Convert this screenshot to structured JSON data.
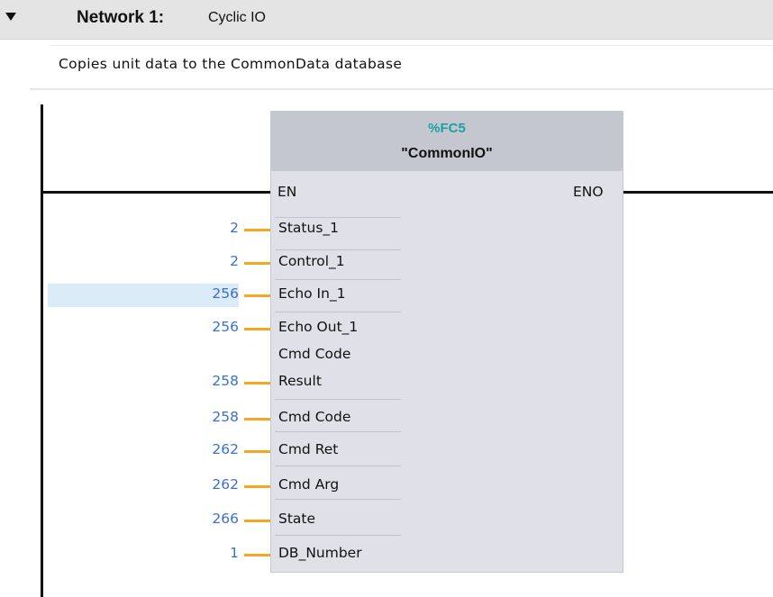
{
  "network": {
    "title": "Network 1:",
    "name": "Cyclic IO",
    "comment": "Copies unit data to the CommonData database",
    "collapse_icon": "triangle-down"
  },
  "block": {
    "address": "%FC5",
    "name": "\"CommonIO\"",
    "en_label": "EN",
    "eno_label": "ENO",
    "inputs": [
      {
        "name": "Status_1",
        "value": "2"
      },
      {
        "name": "Control_1",
        "value": "2"
      },
      {
        "name": "Echo In_1",
        "value": "256"
      },
      {
        "name": "Echo Out_1",
        "value": "256"
      },
      {
        "name": "Cmd Code",
        "value": ""
      },
      {
        "name": "Result",
        "value": "258"
      },
      {
        "name": "Cmd Code",
        "value": "258"
      },
      {
        "name": "Cmd Ret",
        "value": "262"
      },
      {
        "name": "Cmd Arg",
        "value": "262"
      },
      {
        "name": "State",
        "value": "266"
      },
      {
        "name": "DB_Number",
        "value": "1"
      }
    ]
  },
  "colors": {
    "wire": "#f5a623",
    "actual_value": "#3a6fd0",
    "block_address": "#1aa2a2",
    "block_body": "#e0e0e8",
    "block_header": "#c4c6d0",
    "highlight": "#dcebf8"
  }
}
